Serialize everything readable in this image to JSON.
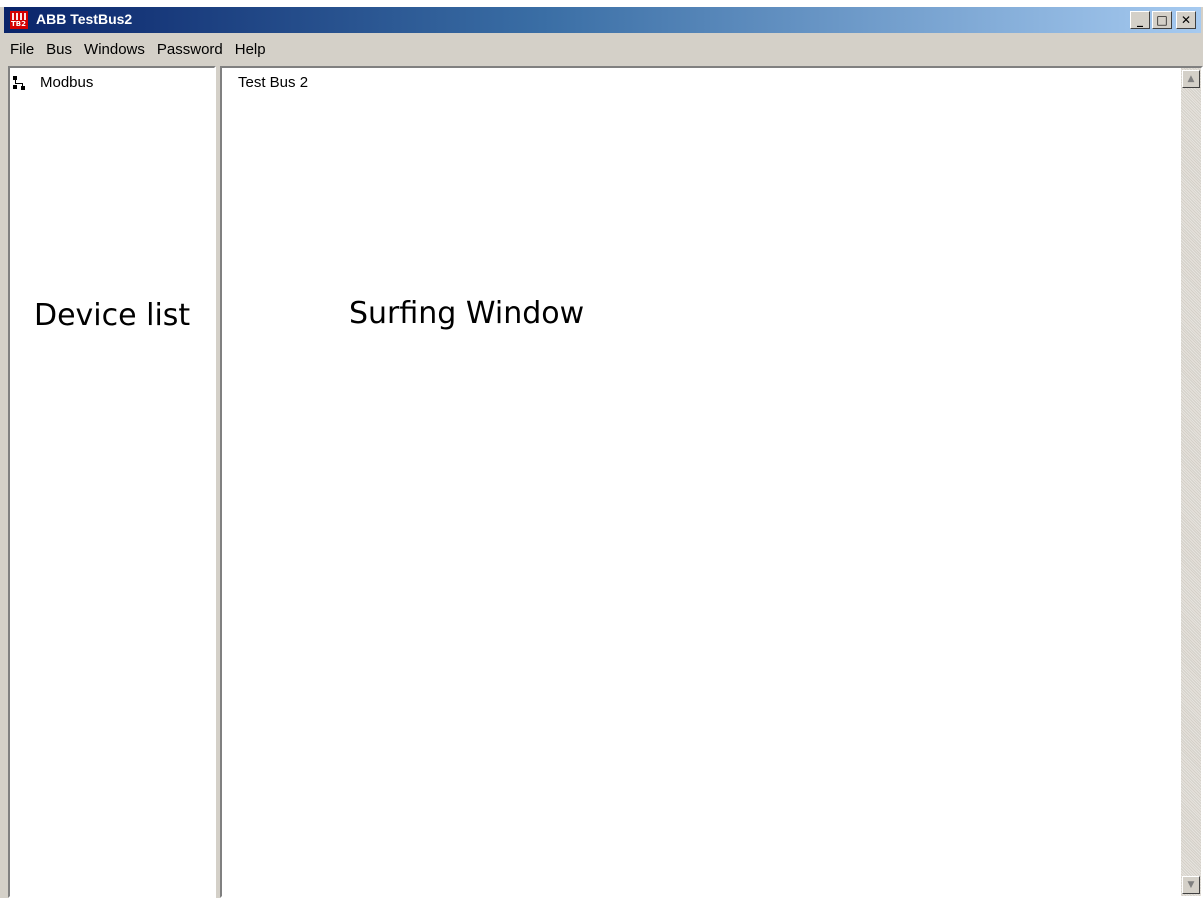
{
  "window": {
    "title": "ABB TestBus2",
    "icon_text": "TB2",
    "controls": {
      "minimize": "_",
      "maximize": "□",
      "close": "✕"
    }
  },
  "menu": [
    "File",
    "Bus",
    "Windows",
    "Password",
    "Help"
  ],
  "device_list": {
    "items": [
      {
        "label": "Modbus",
        "icon": "network-icon"
      }
    ],
    "caption": "Device list"
  },
  "surfing_window": {
    "heading": "Test Bus 2",
    "caption": "Surfing Window"
  },
  "scrollbar": {
    "up": "▲",
    "down": "▼"
  }
}
